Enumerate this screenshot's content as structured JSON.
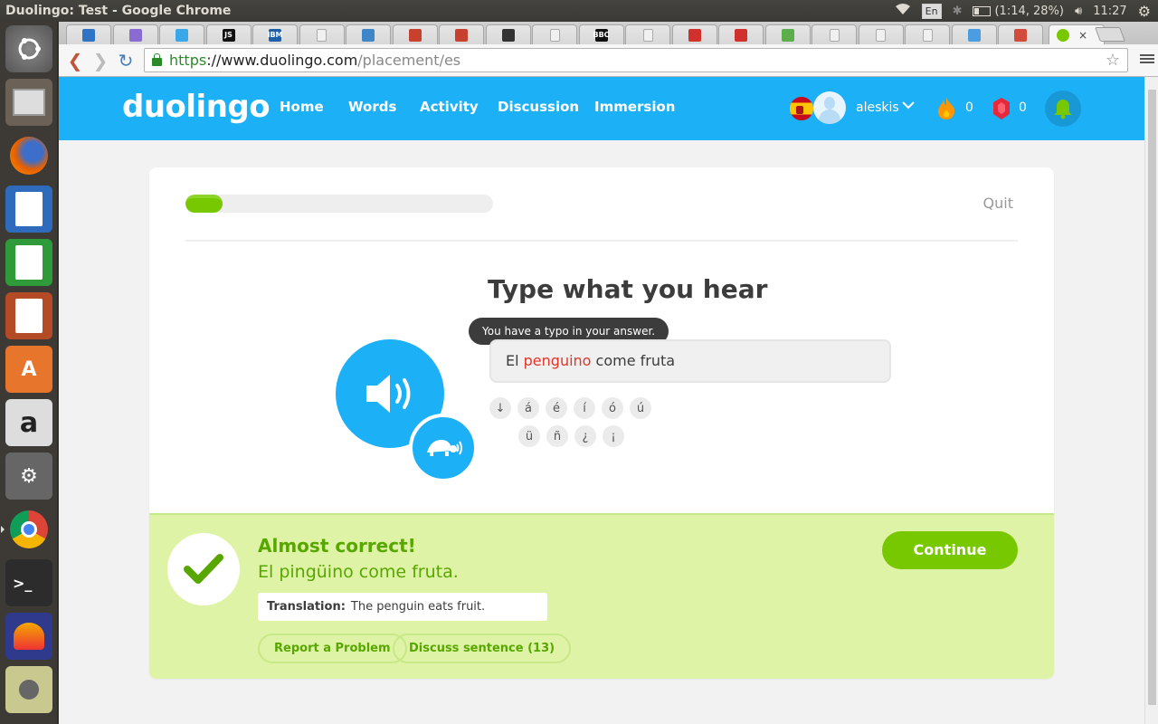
{
  "system": {
    "window_title": "Duolingo: Test - Google Chrome",
    "keyboard_layout": "En",
    "battery": "(1:14, 28%)",
    "clock": "11:27"
  },
  "launcher": {
    "apps": [
      "files-icon",
      "firefox-icon",
      "writer-icon",
      "calc-icon",
      "impress-icon",
      "software-center-icon",
      "amazon-icon",
      "system-settings-icon",
      "chrome-icon",
      "terminal-icon",
      "audacity-icon",
      "disk-icon"
    ]
  },
  "browser": {
    "tab_favicons": [
      {
        "label": "",
        "color": "#2f73c5"
      },
      {
        "label": "",
        "color": "#8a6bd1"
      },
      {
        "label": "",
        "color": "#3aa7e8"
      },
      {
        "label": "JS",
        "color": "#111111"
      },
      {
        "label": "IBM",
        "color": "#1f5ea8"
      },
      {
        "label": "",
        "color": "#f0f0f0"
      },
      {
        "label": "",
        "color": "#3e86c8"
      },
      {
        "label": "",
        "color": "#c8412f"
      },
      {
        "label": "",
        "color": "#c8412f"
      },
      {
        "label": "",
        "color": "#333333"
      },
      {
        "label": "",
        "color": "#f0f0f0"
      },
      {
        "label": "BBC",
        "color": "#111111"
      },
      {
        "label": "",
        "color": "#f0f0f0"
      },
      {
        "label": "",
        "color": "#d0312d"
      },
      {
        "label": "",
        "color": "#d0312d"
      },
      {
        "label": "",
        "color": "#5cae4a"
      },
      {
        "label": "",
        "color": "#f0f0f0"
      },
      {
        "label": "",
        "color": "#f0f0f0"
      },
      {
        "label": "",
        "color": "#f0f0f0"
      },
      {
        "label": "",
        "color": "#4a9de0"
      },
      {
        "label": "",
        "color": "#d24a3a"
      }
    ],
    "active_tab_close": "×",
    "url_scheme": "https",
    "url_host": "://www.duolingo.com",
    "url_path": "/placement/es"
  },
  "header": {
    "logo": "duolingo",
    "nav": [
      "Home",
      "Words",
      "Activity",
      "Discussion",
      "Immersion"
    ],
    "username": "aleskis",
    "streak": "0",
    "gems": "0"
  },
  "lesson": {
    "progress": 0.12,
    "quit_label": "Quit",
    "prompt": "Type what you hear",
    "tooltip": "You have a typo in your answer.",
    "answer_parts": {
      "before": "El ",
      "typo": "penguino",
      "after": " come fruta"
    },
    "special_chars_row1": [
      "↓",
      "á",
      "é",
      "í",
      "ó",
      "ú"
    ],
    "special_chars_row2": [
      "ü",
      "ñ",
      "¿",
      "¡"
    ]
  },
  "feedback": {
    "title": "Almost correct!",
    "correct_answer": "El pingüino come fruta.",
    "translation_label": "Translation:",
    "translation_text": "The penguin eats fruit.",
    "report_label": "Report a Problem",
    "discuss_label": "Discuss sentence (13)",
    "continue_label": "Continue"
  },
  "colors": {
    "brand_blue": "#1cb0f6",
    "success_green": "#78c800",
    "feedback_bg": "#dff3a6",
    "typo_red": "#e2352b"
  }
}
